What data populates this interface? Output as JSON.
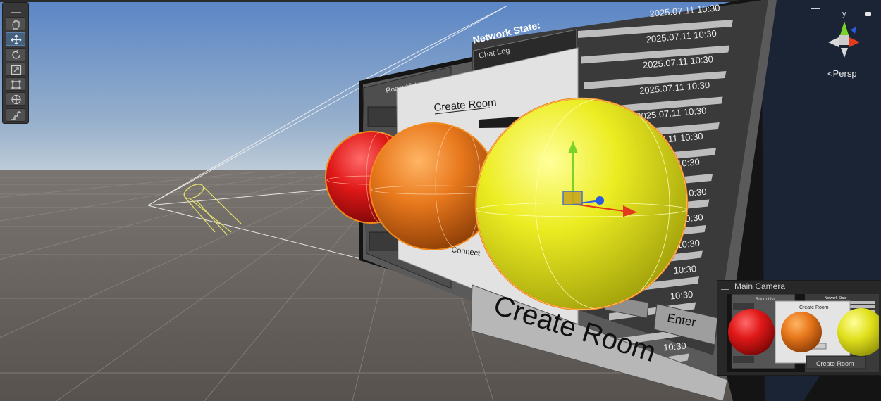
{
  "toolbar": {
    "tools": [
      "view-tool",
      "move-tool",
      "rotate-tool",
      "scale-tool",
      "rect-tool",
      "transform-tool",
      "custom-tool"
    ],
    "active_tool": "move-tool"
  },
  "gizmo": {
    "axis_y": "y",
    "projection_label": "<Persp"
  },
  "ui_panel": {
    "network_state_label": "Network State:",
    "chat_log_label": "Chat Log",
    "room_list_label": "Room List",
    "create_room_title": "Create Room",
    "create_room_button": "Create Room",
    "enter_button": "Enter",
    "connect_button": "Connect",
    "chat_timestamps": [
      "2025.07.11  10:30",
      "2025.07.11  10:30",
      "2025.07.11  10:30",
      "2025.07.11  10:30",
      "2025.07.11  10:30",
      "2025.07.11  10:30",
      "2025.07.11  10:30",
      "10:30",
      "10:30",
      "10:30",
      "10:30",
      "10:30",
      "10:30",
      "10:30"
    ]
  },
  "spheres": [
    {
      "name": "red-sphere",
      "color": "#e01818"
    },
    {
      "name": "orange-sphere",
      "color": "#e8781c"
    },
    {
      "name": "yellow-sphere",
      "color": "#e8e818"
    }
  ],
  "camera_preview": {
    "title": "Main Camera",
    "room_list_label": "Room List",
    "network_state_label": "Network State",
    "create_room_title": "Create Room",
    "create_room_button": "Create Room"
  },
  "colors": {
    "sky_top": "#5a85c5",
    "sky_horizon": "#c3cfd9",
    "ground": "#5e5a56",
    "selection_outline": "#f08a1c",
    "axis_x": "#e23a1a",
    "axis_y": "#7ad32a",
    "axis_z": "#2a5ce0"
  }
}
